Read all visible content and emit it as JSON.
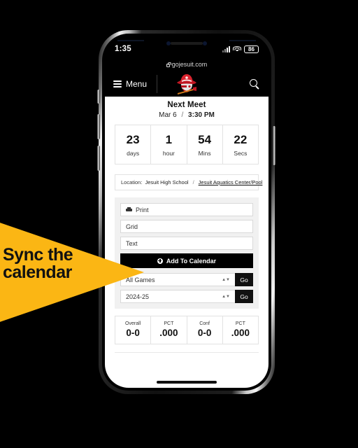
{
  "device": {
    "status_bar": {
      "time": "1:35",
      "battery": "86",
      "signal_icon": "cellular-bars-icon",
      "wifi_icon": "wifi-icon"
    },
    "url_bar": {
      "lock_icon": "lock-icon",
      "url": "gojesuit.com"
    }
  },
  "site_header": {
    "menu_label": "Menu",
    "menu_icon": "hamburger-icon",
    "logo_name": "jesuit-marauders-logo",
    "search_icon": "search-icon"
  },
  "next_meet": {
    "title": "Next Meet",
    "date": "Mar 6",
    "separator": "/",
    "time": "3:30 PM"
  },
  "countdown": {
    "units": [
      {
        "value": "23",
        "label": "days"
      },
      {
        "value": "1",
        "label": "hour"
      },
      {
        "value": "54",
        "label": "Mins"
      },
      {
        "value": "22",
        "label": "Secs"
      }
    ]
  },
  "location": {
    "label": "Location:",
    "venue": "Jesuit High School",
    "separator": "/",
    "link": "Jesuit Aquatics Center/Pool"
  },
  "options": {
    "print_label": "Print",
    "print_icon": "printer-icon",
    "grid_label": "Grid",
    "text_label": "Text",
    "add_calendar_label": "Add To Calendar",
    "add_calendar_icon": "plus-circle-icon",
    "selects": [
      {
        "value": "All Games",
        "go_label": "Go",
        "stepper_icon": "stepper-updown-icon"
      },
      {
        "value": "2024-25",
        "go_label": "Go",
        "stepper_icon": "stepper-updown-icon"
      }
    ]
  },
  "stats": {
    "cells": [
      {
        "label": "Overall",
        "value": "0-0"
      },
      {
        "label": "PCT",
        "value": ".000"
      },
      {
        "label": "Conf",
        "value": "0-0"
      },
      {
        "label": "PCT",
        "value": ".000"
      }
    ]
  },
  "callout": {
    "line1": "Sync the",
    "line2": "calendar",
    "color": "#FBB614"
  }
}
